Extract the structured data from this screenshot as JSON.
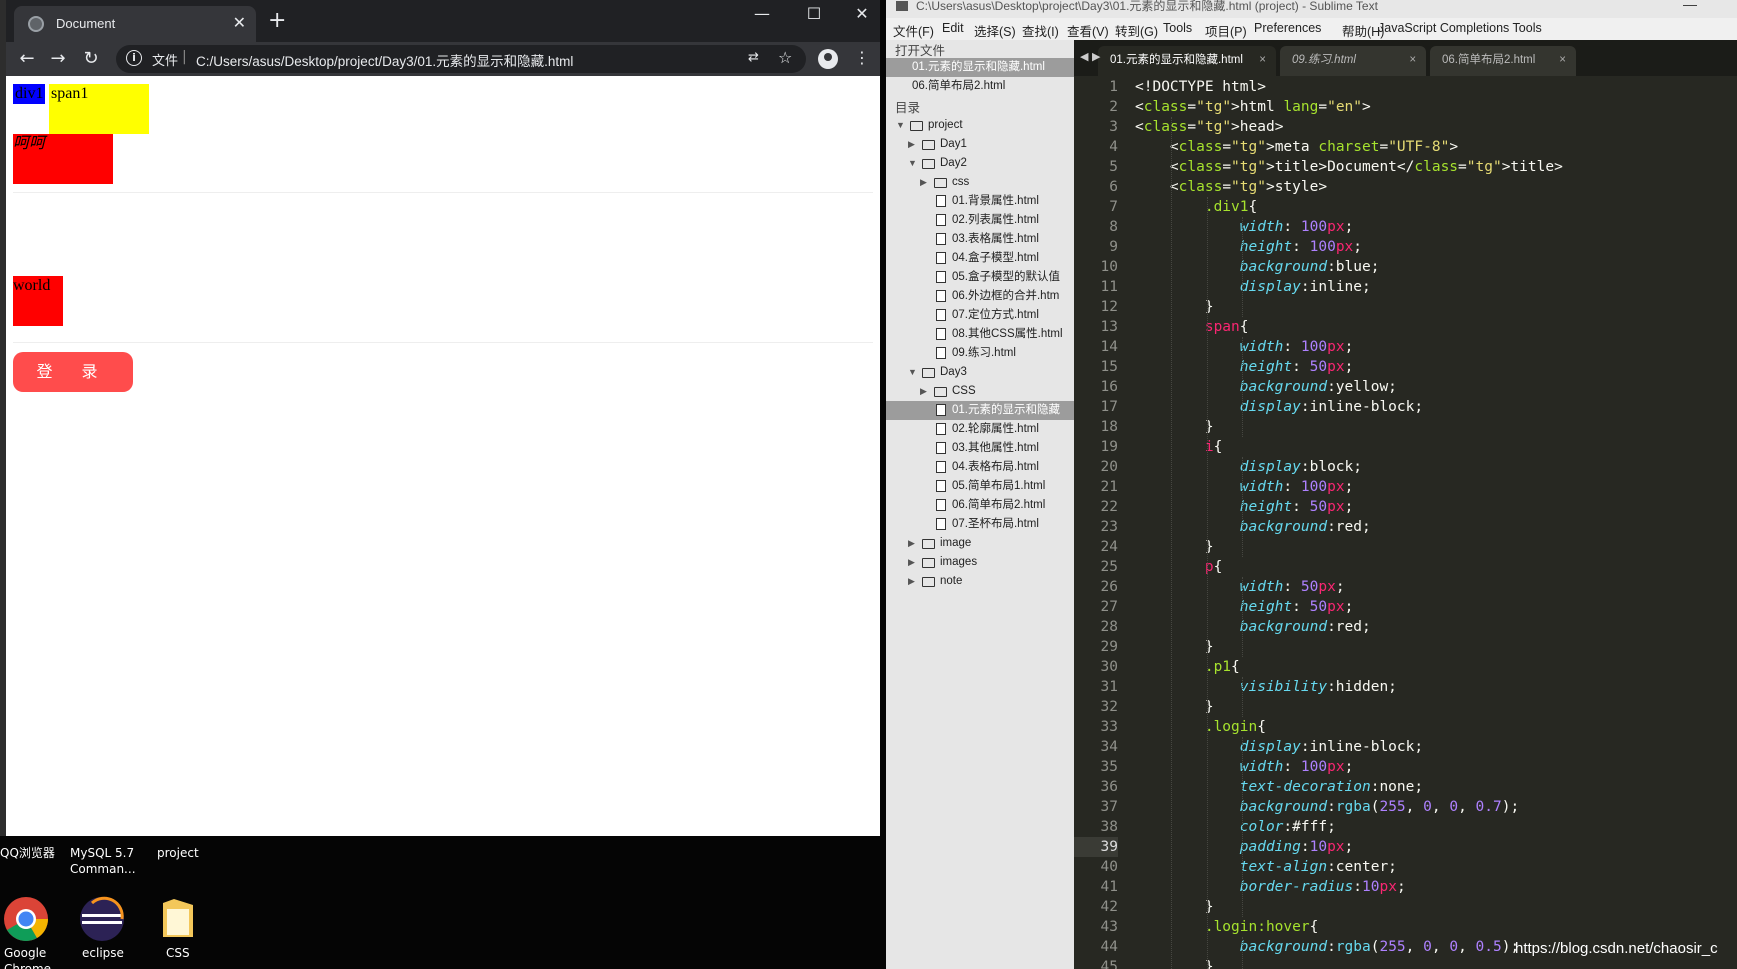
{
  "browser": {
    "tab_title": "Document",
    "address_scheme": "文件",
    "address_url": "C:/Users/asus/Desktop/project/Day3/01.元素的显示和隐藏.html",
    "page": {
      "div1_text": "div1",
      "span1_text": "span1",
      "i_text": "呵呵",
      "p_text": "world",
      "login_label": "登 录"
    }
  },
  "desktop": {
    "labels": [
      "QQ浏览器",
      "MySQL 5.7 Comman...",
      "project",
      "Google Chrome",
      "eclipse",
      "CSS"
    ]
  },
  "editor": {
    "window_title": "C:\\Users\\asus\\Desktop\\project\\Day3\\01.元素的显示和隐藏.html (project) - Sublime Text",
    "menu": [
      "文件(F)",
      "Edit",
      "选择(S)",
      "查找(I)",
      "查看(V)",
      "转到(G)",
      "Tools",
      "项目(P)",
      "Preferences",
      "帮助(H)",
      "JavaScript Completions Tools"
    ],
    "sidebar": {
      "open_files_header": "打开文件",
      "open_files": [
        "01.元素的显示和隐藏.html",
        "06.简单布局2.html"
      ],
      "folders_header": "目录",
      "tree": [
        {
          "name": "project",
          "level": 0,
          "kind": "folder-open"
        },
        {
          "name": "Day1",
          "level": 1,
          "kind": "folder"
        },
        {
          "name": "Day2",
          "level": 1,
          "kind": "folder-open"
        },
        {
          "name": "css",
          "level": 2,
          "kind": "folder"
        },
        {
          "name": "01.背景属性.html",
          "level": 2,
          "kind": "file"
        },
        {
          "name": "02.列表属性.html",
          "level": 2,
          "kind": "file"
        },
        {
          "name": "03.表格属性.html",
          "level": 2,
          "kind": "file"
        },
        {
          "name": "04.盒子模型.html",
          "level": 2,
          "kind": "file"
        },
        {
          "name": "05.盒子模型的默认值",
          "level": 2,
          "kind": "file"
        },
        {
          "name": "06.外边框的合并.htm",
          "level": 2,
          "kind": "file"
        },
        {
          "name": "07.定位方式.html",
          "level": 2,
          "kind": "file"
        },
        {
          "name": "08.其他CSS属性.html",
          "level": 2,
          "kind": "file"
        },
        {
          "name": "09.练习.html",
          "level": 2,
          "kind": "file"
        },
        {
          "name": "Day3",
          "level": 1,
          "kind": "folder-open"
        },
        {
          "name": "CSS",
          "level": 2,
          "kind": "folder"
        },
        {
          "name": "01.元素的显示和隐藏",
          "level": 2,
          "kind": "file",
          "selected": true
        },
        {
          "name": "02.轮廓属性.html",
          "level": 2,
          "kind": "file"
        },
        {
          "name": "03.其他属性.html",
          "level": 2,
          "kind": "file"
        },
        {
          "name": "04.表格布局.html",
          "level": 2,
          "kind": "file"
        },
        {
          "name": "05.简单布局1.html",
          "level": 2,
          "kind": "file"
        },
        {
          "name": "06.简单布局2.html",
          "level": 2,
          "kind": "file"
        },
        {
          "name": "07.圣杯布局.html",
          "level": 2,
          "kind": "file"
        },
        {
          "name": "image",
          "level": 1,
          "kind": "folder"
        },
        {
          "name": "images",
          "level": 1,
          "kind": "folder"
        },
        {
          "name": "note",
          "level": 1,
          "kind": "folder"
        }
      ]
    },
    "tabs": [
      {
        "label": "01.元素的显示和隐藏.html",
        "active": true
      },
      {
        "label": "09.练习.html",
        "active": false
      },
      {
        "label": "06.简单布局2.html",
        "active": false
      }
    ],
    "current_line": 39,
    "code": [
      "<!DOCTYPE html>",
      "<html lang=\"en\">",
      "<head>",
      "    <meta charset=\"UTF-8\">",
      "    <title>Document</title>",
      "    <style>",
      "        .div1{",
      "            width: 100px;",
      "            height: 100px;",
      "            background:blue;",
      "            display:inline;",
      "        }",
      "        span{",
      "            width: 100px;",
      "            height: 50px;",
      "            background:yellow;",
      "            display:inline-block;",
      "        }",
      "        i{",
      "            display:block;",
      "            width: 100px;",
      "            height: 50px;",
      "            background:red;",
      "        }",
      "        p{",
      "            width: 50px;",
      "            height: 50px;",
      "            background:red;",
      "        }",
      "        .p1{",
      "            visibility:hidden;",
      "        }",
      "        .login{",
      "            display:inline-block;",
      "            width: 100px;",
      "            text-decoration:none;",
      "            background:rgba(255, 0, 0, 0.7);",
      "            color:#fff;",
      "            padding:10px;",
      "            text-align:center;",
      "            border-radius:10px;",
      "        }",
      "        .login:hover{",
      "            background:rgba(255, 0, 0, 0.5);",
      "        }"
    ],
    "line_count": 45
  },
  "watermark": "https://blog.csdn.net/chaosir_c"
}
